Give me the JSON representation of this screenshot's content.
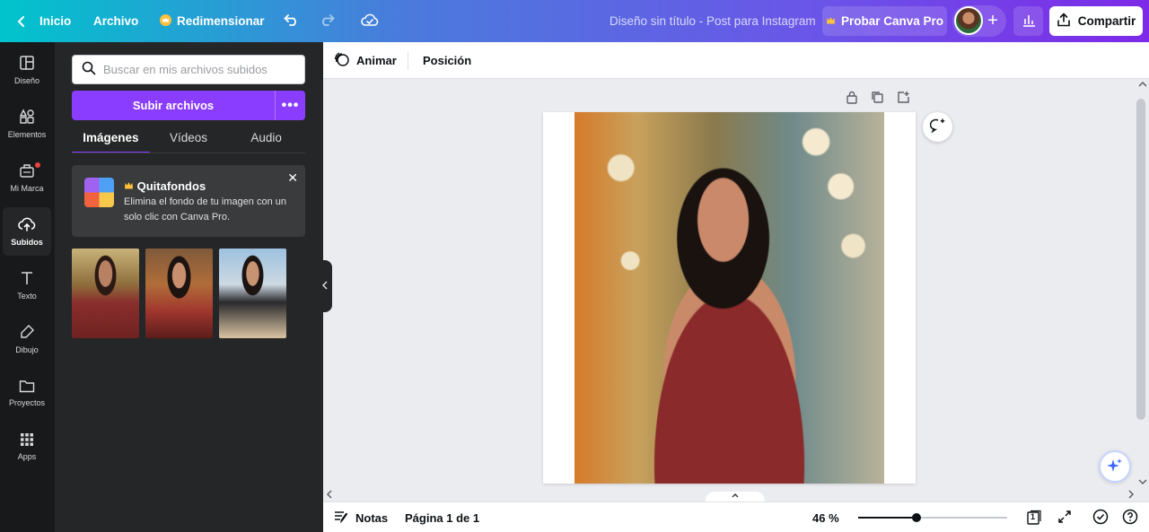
{
  "topbar": {
    "home_label": "Inicio",
    "file_label": "Archivo",
    "resize_label": "Redimensionar",
    "doc_title": "Diseño sin título - Post para Instagram",
    "pro_label": "Probar Canva Pro",
    "plus_symbol": "+",
    "share_label": "Compartir"
  },
  "rail": {
    "items": [
      {
        "label": "Diseño",
        "icon": "layout-icon"
      },
      {
        "label": "Elementos",
        "icon": "shapes-icon"
      },
      {
        "label": "Mi Marca",
        "icon": "brand-icon"
      },
      {
        "label": "Subidos",
        "icon": "cloud-upload-icon",
        "active": true
      },
      {
        "label": "Texto",
        "icon": "text-icon"
      },
      {
        "label": "Dibujo",
        "icon": "draw-icon"
      },
      {
        "label": "Proyectos",
        "icon": "folder-icon"
      },
      {
        "label": "Apps",
        "icon": "apps-grid-icon"
      }
    ]
  },
  "panel": {
    "search_placeholder": "Buscar en mis archivos subidos",
    "upload_label": "Subir archivos",
    "more_symbol": "•••",
    "tabs": [
      "Imágenes",
      "Vídeos",
      "Audio"
    ],
    "active_tab": "Imágenes",
    "promo": {
      "title": "Quitafondos",
      "text": "Elimina el fondo de tu imagen con un solo clic con Canva Pro.",
      "close_symbol": "✕"
    }
  },
  "ctxbar": {
    "animate_label": "Animar",
    "position_label": "Posición"
  },
  "bottombar": {
    "notes_label": "Notas",
    "page_label": "Página 1 de 1",
    "zoom_label": "46 %",
    "zoom_value": 46,
    "page_count": "1"
  },
  "colors": {
    "accent": "#8b3dff",
    "topbar_start": "#00c4cc",
    "topbar_end": "#7d2ae8"
  }
}
